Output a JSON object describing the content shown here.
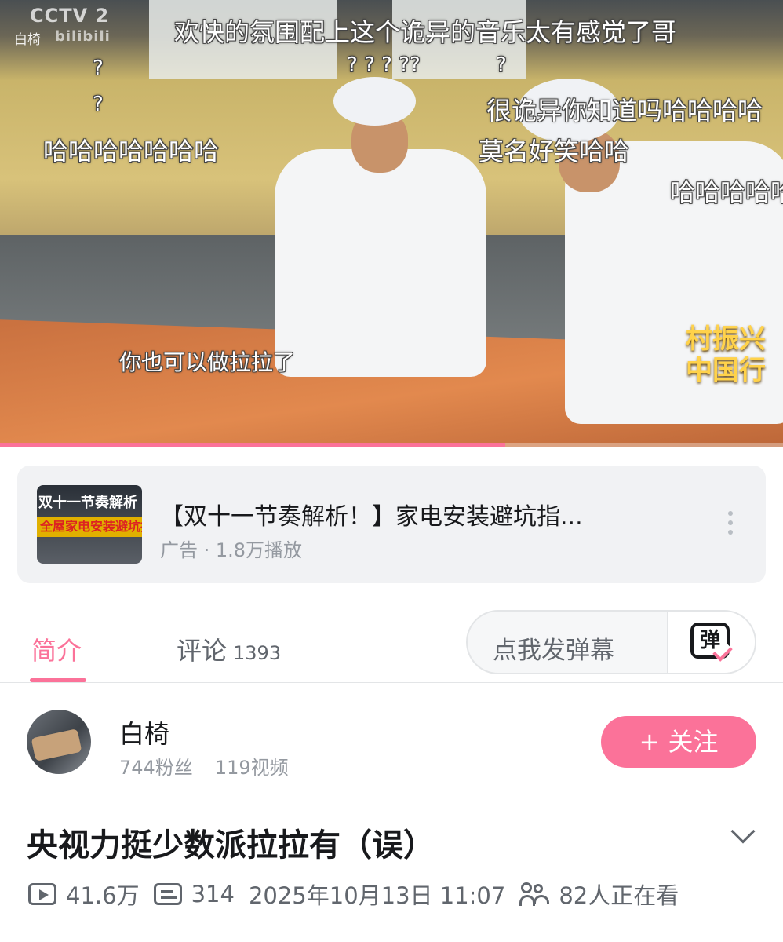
{
  "player": {
    "channel_logo": "CCTV 2",
    "channel_sub": "白椅",
    "watermark": "bilibili",
    "danmaku": [
      "欢快的氛围配上这个诡异的音乐太有感觉了哥",
      "哈哈哈哈哈哈哈",
      "很诡异你知道吗哈哈哈哈",
      "莫名好笑哈哈",
      "哈哈哈哈哈",
      "? ?  ?  ??",
      "?"
    ],
    "subtitle": "你也可以做拉拉了",
    "brand_line1": "村振兴",
    "brand_line2": "中国行",
    "progress_fraction": 0.645,
    "colors": {
      "accent": "#fb7299"
    }
  },
  "ad": {
    "thumb_text1": "双十一节奏解析",
    "thumb_text2": "全屋家电安装避坑指南",
    "title": "【双十一节奏解析！】家电安装避坑指...",
    "meta": "广告 · 1.8万播放",
    "more_icon": "more-vertical-icon"
  },
  "tabs": {
    "intro": "简介",
    "comments": "评论",
    "comments_count": "1393"
  },
  "danmaku_input": {
    "placeholder": "点我发弹幕",
    "toggle_label": "弹"
  },
  "uploader": {
    "name": "白椅",
    "fans": "744粉丝",
    "videos": "119视频",
    "follow_label": "+ 关注"
  },
  "video": {
    "title": "央视力挺少数派拉拉有（误）",
    "views": "41.6万",
    "danmaku_count": "314",
    "date": "2025年10月13日 11:07",
    "watching": "82人正在看"
  }
}
